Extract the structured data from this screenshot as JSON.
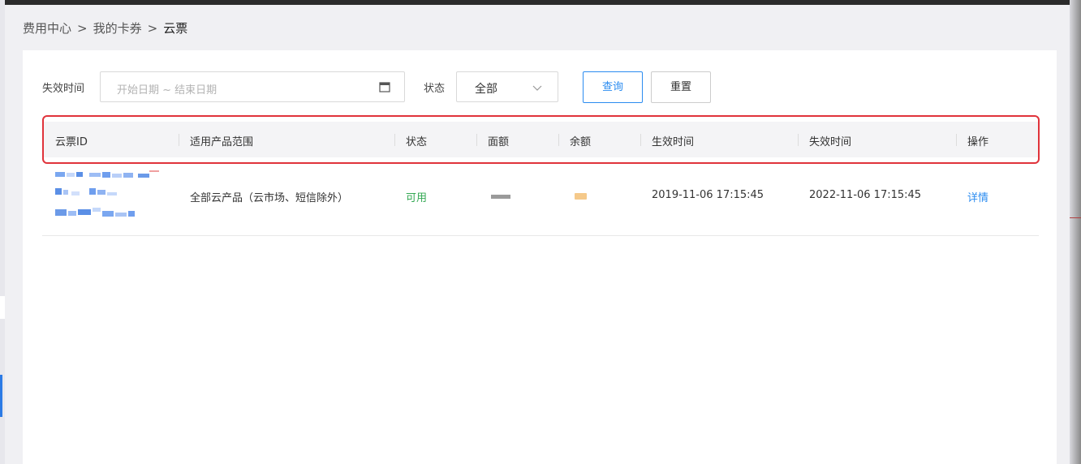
{
  "breadcrumb": {
    "items": [
      "费用中心",
      "我的卡券",
      "云票"
    ],
    "separator": ">"
  },
  "filters": {
    "expire_label": "失效时间",
    "date_placeholder": "开始日期 ~ 结束日期",
    "status_label": "状态",
    "status_value": "全部",
    "query_button": "查询",
    "reset_button": "重置"
  },
  "table": {
    "columns": [
      "云票ID",
      "适用产品范围",
      "状态",
      "面额",
      "余额",
      "生效时间",
      "失效时间",
      "操作"
    ],
    "rows": [
      {
        "id": "",
        "scope": "全部云产品（云市场、短信除外）",
        "status": "可用",
        "face_value": "",
        "balance": "",
        "effective_time": "2019-11-06 17:15:45",
        "expire_time": "2022-11-06 17:15:45",
        "action": "详情"
      }
    ]
  },
  "colors": {
    "accent": "#2b8cf0",
    "status_available": "#34a853",
    "highlight_border": "#e0333b"
  },
  "icons": [
    "calendar-icon",
    "chevron-down-icon"
  ]
}
